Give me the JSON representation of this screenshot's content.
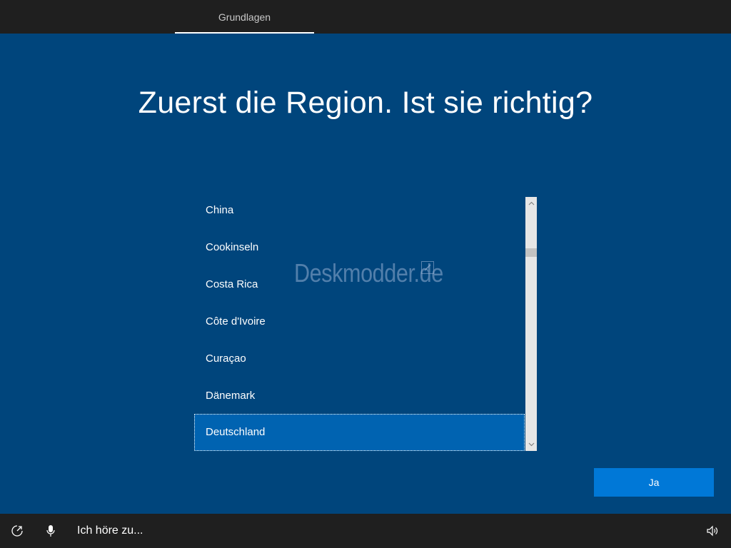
{
  "header": {
    "tab_label": "Grundlagen"
  },
  "main": {
    "title": "Zuerst die Region. Ist sie richtig?",
    "region_list": {
      "items": [
        {
          "label": "China"
        },
        {
          "label": "Cookinseln"
        },
        {
          "label": "Costa Rica"
        },
        {
          "label": "Côte d'Ivoire"
        },
        {
          "label": "Curaçao"
        },
        {
          "label": "Dänemark"
        },
        {
          "label": "Deutschland"
        }
      ],
      "selected": "Deutschland"
    },
    "watermark": "Deskmodder.de",
    "confirm_button": "Ja"
  },
  "footer": {
    "ease_of_access_icon": "ease-of-access-icon",
    "microphone_icon": "microphone-icon",
    "listening_text": "Ich höre zu...",
    "volume_icon": "volume-icon"
  },
  "colors": {
    "background": "#00457c",
    "bars": "#1f1f1f",
    "selected_item": "#0063b1",
    "accent_button": "#0078d7"
  }
}
